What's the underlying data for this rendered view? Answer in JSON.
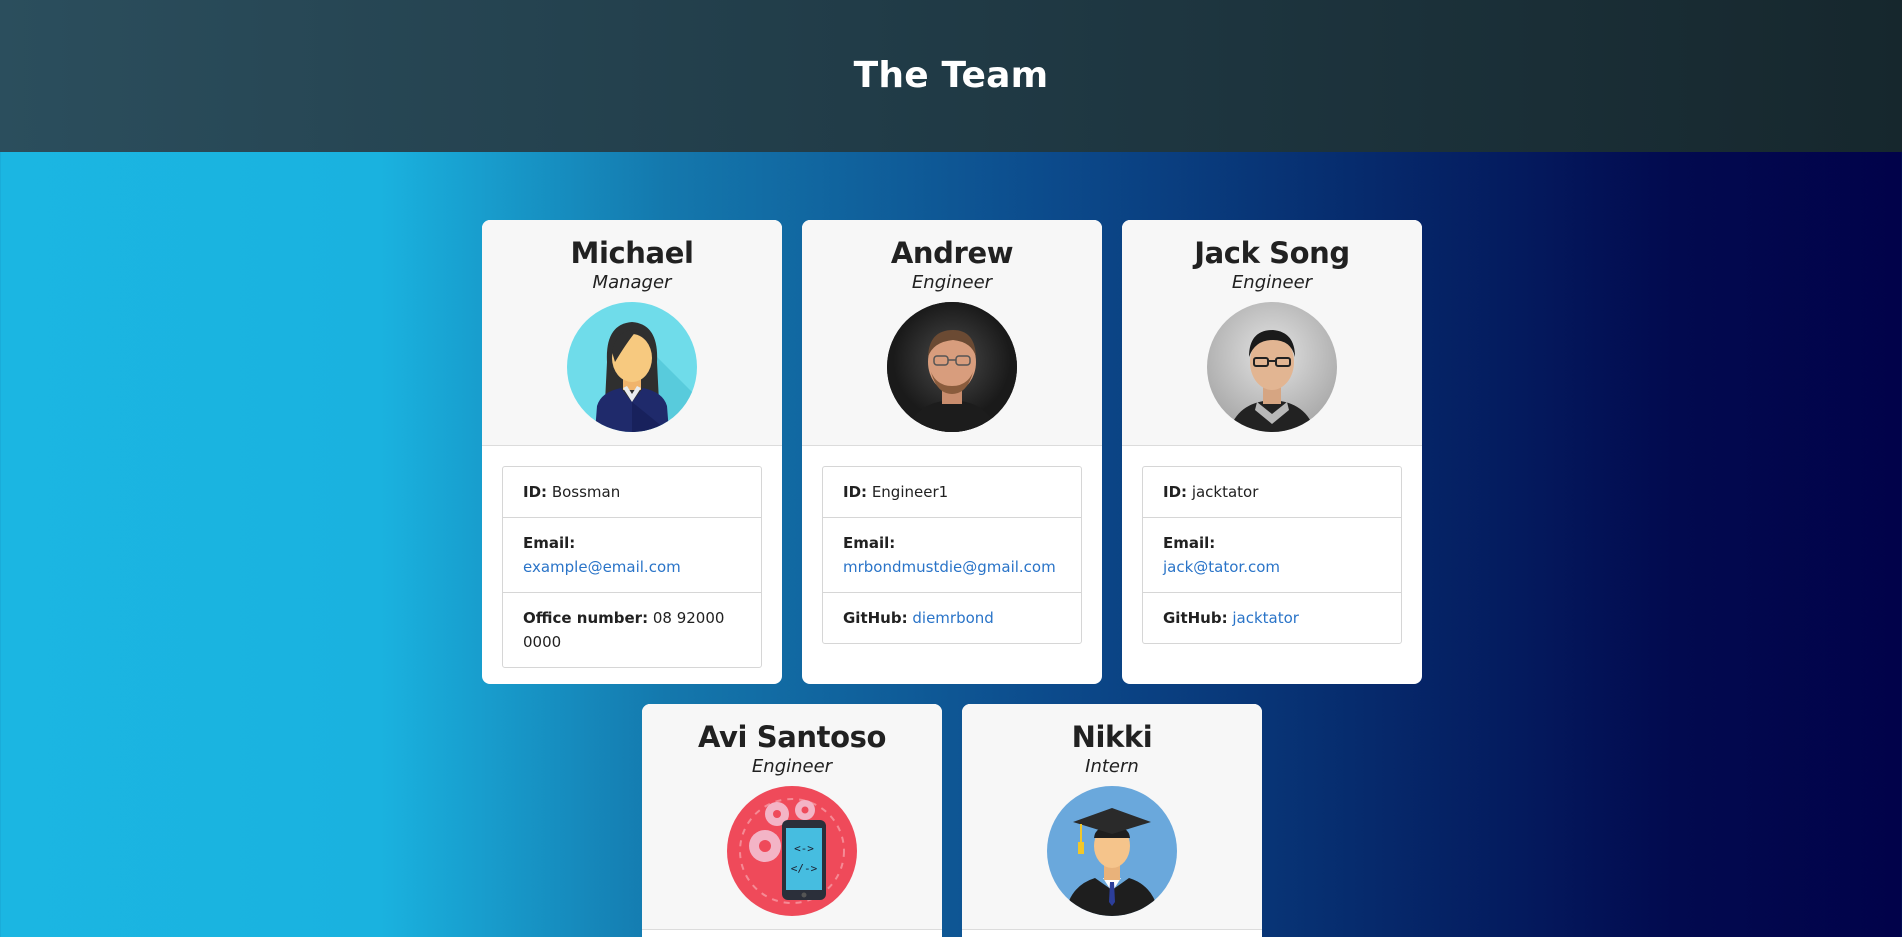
{
  "header": {
    "title": "The Team"
  },
  "cards": [
    {
      "name": "Michael",
      "role": "Manager",
      "avatar": "manager-woman-icon",
      "id_label": "ID:",
      "id_value": "Bossman",
      "email_label": "Email:",
      "email_value": "example@email.com",
      "extra_label": "Office number:",
      "extra_value": "08 92000 0000"
    },
    {
      "name": "Andrew",
      "role": "Engineer",
      "avatar": "photo-andrew",
      "id_label": "ID:",
      "id_value": "Engineer1",
      "email_label": "Email:",
      "email_value": "mrbondmustdie@gmail.com",
      "extra_label": "GitHub:",
      "extra_value": "diemrbond"
    },
    {
      "name": "Jack Song",
      "role": "Engineer",
      "avatar": "photo-jack",
      "id_label": "ID:",
      "id_value": "jacktator",
      "email_label": "Email:",
      "email_value": "jack@tator.com",
      "extra_label": "GitHub:",
      "extra_value": "jacktator"
    },
    {
      "name": "Avi Santoso",
      "role": "Engineer",
      "avatar": "mobile-dev-icon"
    },
    {
      "name": "Nikki",
      "role": "Intern",
      "avatar": "graduate-icon"
    }
  ]
}
